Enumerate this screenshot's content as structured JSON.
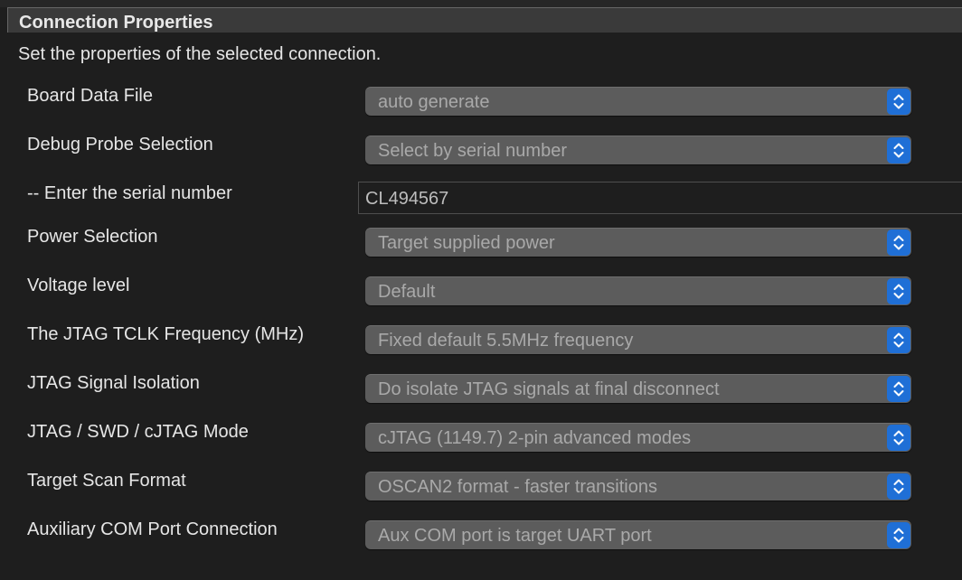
{
  "panel": {
    "title": "Connection Properties",
    "description": "Set the properties of the selected connection."
  },
  "properties": [
    {
      "label": "Board Data File",
      "type": "select",
      "value": "auto generate"
    },
    {
      "label": "Debug Probe Selection",
      "type": "select",
      "value": "Select by serial number"
    },
    {
      "label": "-- Enter the serial number",
      "type": "text",
      "value": "CL494567"
    },
    {
      "label": "Power Selection",
      "type": "select",
      "value": "Target supplied power"
    },
    {
      "label": "Voltage level",
      "type": "select",
      "value": "Default"
    },
    {
      "label": "The JTAG TCLK Frequency (MHz)",
      "type": "select",
      "value": "Fixed default 5.5MHz frequency"
    },
    {
      "label": "JTAG Signal Isolation",
      "type": "select",
      "value": "Do isolate JTAG signals at final disconnect"
    },
    {
      "label": "JTAG / SWD / cJTAG Mode",
      "type": "select",
      "value": "cJTAG (1149.7) 2-pin advanced modes"
    },
    {
      "label": "Target Scan Format",
      "type": "select",
      "value": "OSCAN2 format - faster transitions"
    },
    {
      "label": "Auxiliary COM Port Connection",
      "type": "select",
      "value": "Aux COM port is target UART port"
    }
  ],
  "icons": {
    "stepper": "chevron-up-down-icon"
  },
  "colors": {
    "background": "#1e1e1e",
    "header": "#3a3a3a",
    "select_bg": "#5c5c5c",
    "accent": "#1f6fd6",
    "label_text": "#e6e6e6",
    "value_text": "#a9a9a9"
  }
}
